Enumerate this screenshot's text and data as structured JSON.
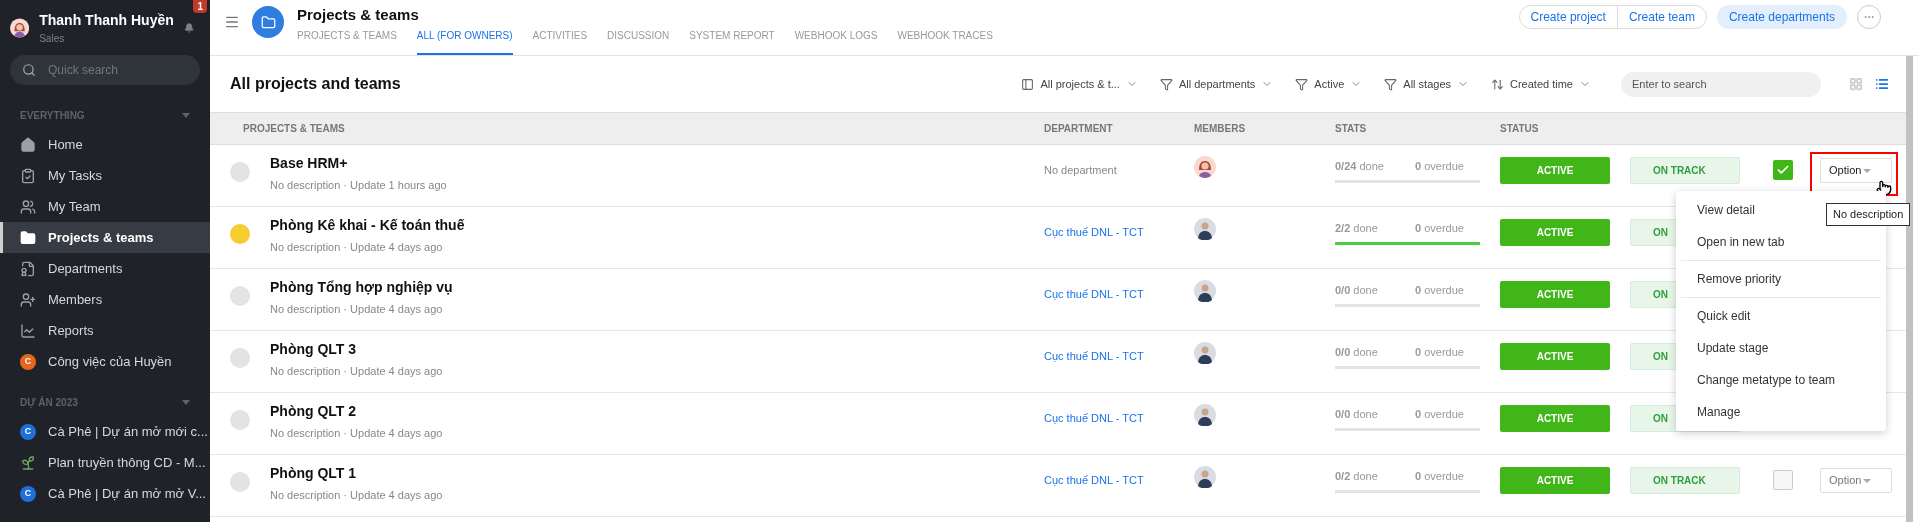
{
  "sidebar": {
    "user": {
      "name": "Thanh Thanh Huyền",
      "role": "Sales",
      "notifications": "1"
    },
    "search": {
      "placeholder": "Quick search"
    },
    "sections": [
      {
        "title": "EVERYTHING",
        "items": [
          {
            "label": "Home",
            "kind": "home",
            "selected": false
          },
          {
            "label": "My Tasks",
            "kind": "tasks",
            "selected": false
          },
          {
            "label": "My Team",
            "kind": "team",
            "selected": false
          },
          {
            "label": "Projects & teams",
            "kind": "folder",
            "selected": true
          },
          {
            "label": "Departments",
            "kind": "departments",
            "selected": false
          },
          {
            "label": "Members",
            "kind": "members",
            "selected": false
          },
          {
            "label": "Reports",
            "kind": "reports",
            "selected": false
          },
          {
            "label": "Công việc của Huyền",
            "kind": "letter",
            "letter": "C",
            "color": "#e8651c",
            "selected": false
          }
        ]
      },
      {
        "title": "DỰ ÁN 2023",
        "items": [
          {
            "label": "Cà Phê | Dự án mở mới c...",
            "kind": "letter",
            "letter": "C",
            "color": "#1e6fd9",
            "selected": false
          },
          {
            "label": "Plan truyền thông CD - M...",
            "kind": "plant",
            "selected": false
          },
          {
            "label": "Cà Phê | Dự án mở mở V...",
            "kind": "letter",
            "letter": "C",
            "color": "#1e6fd9",
            "selected": false
          }
        ]
      }
    ]
  },
  "header": {
    "title": "Projects & teams",
    "tabs": [
      {
        "label": "PROJECTS & TEAMS",
        "selected": false
      },
      {
        "label": "ALL (FOR OWNERS)",
        "selected": true
      },
      {
        "label": "ACTIVITIES",
        "selected": false
      },
      {
        "label": "DISCUSSION",
        "selected": false
      },
      {
        "label": "SYSTEM REPORT",
        "selected": false
      },
      {
        "label": "WEBHOOK LOGS",
        "selected": false
      },
      {
        "label": "WEBHOOK TRACES",
        "selected": false
      }
    ],
    "buttons": [
      "Create project",
      "Create team"
    ],
    "primary_button": "Create departments"
  },
  "toolbar": {
    "title": "All projects and teams",
    "filters": [
      {
        "label": "All projects & t...",
        "kind": "panel"
      },
      {
        "label": "All departments",
        "kind": "filter"
      },
      {
        "label": "Active",
        "kind": "filter"
      },
      {
        "label": "All stages",
        "kind": "filter"
      },
      {
        "label": "Created time",
        "kind": "sort"
      }
    ],
    "search": {
      "placeholder": "Enter to search"
    },
    "views": [
      {
        "kind": "grid",
        "selected": false
      },
      {
        "kind": "list",
        "selected": true
      }
    ]
  },
  "table": {
    "columns": [
      "PROJECTS & TEAMS",
      "DEPARTMENT",
      "MEMBERS",
      "STATS",
      "STATUS"
    ],
    "rows": [
      {
        "color": "#e3e3e3",
        "name": "Base HRM+",
        "meta": "No description · Update 1 hours ago",
        "department": {
          "text": "No department",
          "kind": "plain"
        },
        "member": {
          "kind": "female"
        },
        "done": "**0/24** done",
        "overdue": "**0** overdue",
        "level": 0,
        "status": "ACTIVE",
        "track": "ON TRACK",
        "checked": true,
        "option": "Option"
      },
      {
        "color": "#f5cd2e",
        "name": "Phòng Kê khai - Kế toán thuế",
        "meta": "No description · Update 4 days ago",
        "department": {
          "text": "Cục thuế DNL - TCT",
          "kind": "link"
        },
        "member": {
          "kind": "male"
        },
        "done": "**2/2** done",
        "overdue": "**0** overdue",
        "level": 1,
        "status": "ACTIVE",
        "track": "ON"
      },
      {
        "color": "#e3e3e3",
        "name": "Phòng Tổng hợp nghiệp vụ",
        "meta": "No description · Update 4 days ago",
        "department": {
          "text": "Cục thuế DNL - TCT",
          "kind": "link"
        },
        "member": {
          "kind": "male"
        },
        "done": "**0/0** done",
        "overdue": "**0** overdue",
        "level": 0,
        "status": "ACTIVE",
        "track": "ON"
      },
      {
        "color": "#e3e3e3",
        "name": "Phòng QLT 3",
        "meta": "No description · Update 4 days ago",
        "department": {
          "text": "Cục thuế DNL - TCT",
          "kind": "link"
        },
        "member": {
          "kind": "male"
        },
        "done": "**0/0** done",
        "overdue": "**0** overdue",
        "level": 0,
        "status": "ACTIVE",
        "track": "ON"
      },
      {
        "color": "#e3e3e3",
        "name": "Phòng QLT 2",
        "meta": "No description · Update 4 days ago",
        "department": {
          "text": "Cục thuế DNL - TCT",
          "kind": "link"
        },
        "member": {
          "kind": "male"
        },
        "done": "**0/0** done",
        "overdue": "**0** overdue",
        "level": 0,
        "status": "ACTIVE",
        "track": "ON"
      },
      {
        "color": "#e3e3e3",
        "name": "Phòng QLT 1",
        "meta": "No description · Update 4 days ago",
        "department": {
          "text": "Cục thuế DNL - TCT",
          "kind": "link"
        },
        "member": {
          "kind": "male"
        },
        "done": "**0/2** done",
        "overdue": "**0** overdue",
        "level": 0,
        "status": "ACTIVE",
        "track": "ON TRACK",
        "checked": false,
        "option": "Option"
      }
    ]
  },
  "menu": {
    "groups": [
      [
        "View detail",
        "Open in new tab"
      ],
      [
        "Remove priority"
      ],
      [
        "Quick edit",
        "Update stage",
        "Change metatype to team",
        "Manage"
      ]
    ]
  },
  "tooltip": "No description"
}
